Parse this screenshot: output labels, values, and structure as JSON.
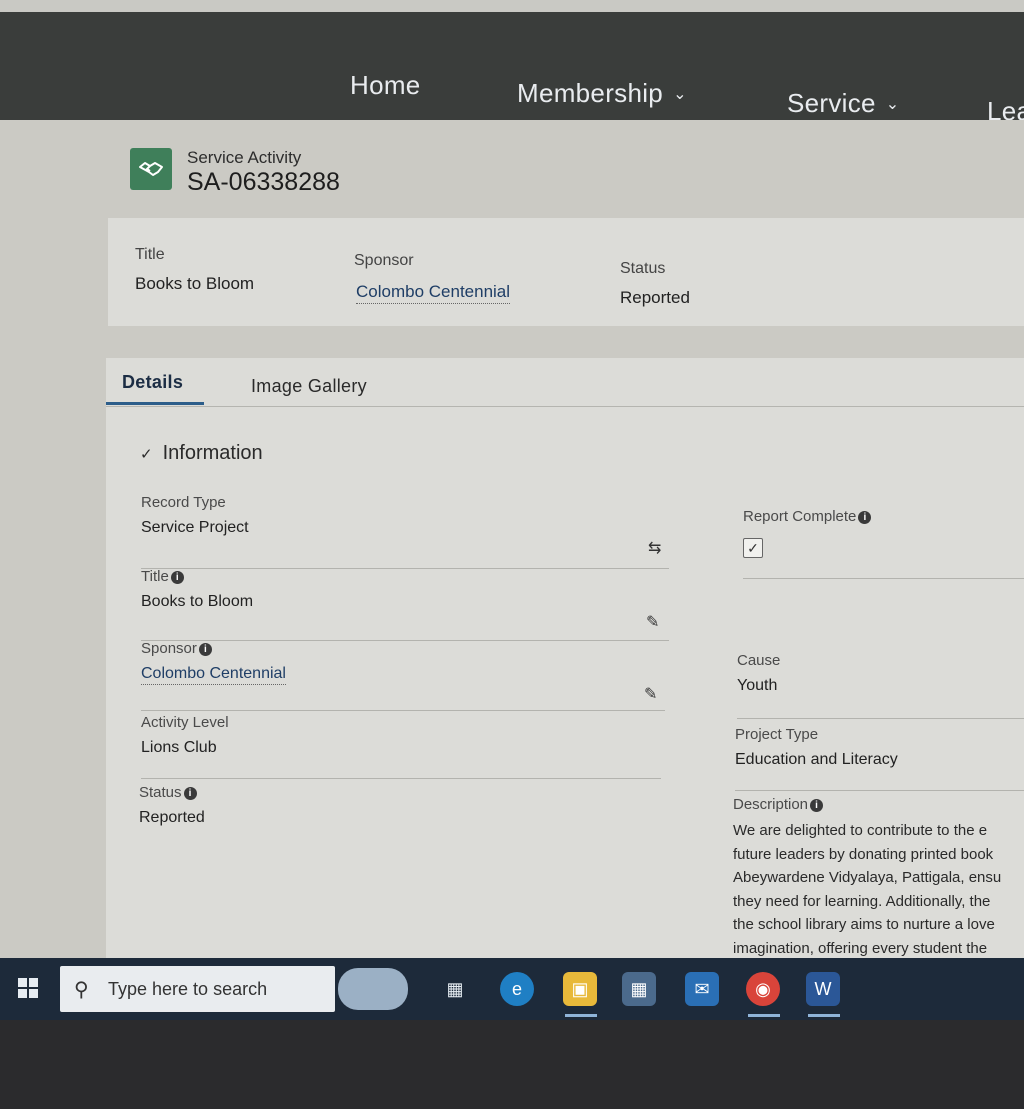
{
  "nav": {
    "home": "Home",
    "membership": "Membership",
    "service": "Service",
    "more": "Lea"
  },
  "record": {
    "object_label": "Service Activity",
    "number": "SA-06338288"
  },
  "highlights": {
    "title_label": "Title",
    "title_value": "Books to Bloom",
    "sponsor_label": "Sponsor",
    "sponsor_value": "Colombo Centennial",
    "status_label": "Status",
    "status_value": "Reported"
  },
  "tabs": [
    {
      "label": "Details",
      "active": true
    },
    {
      "label": "Image Gallery",
      "active": false
    }
  ],
  "section": {
    "title": "Information"
  },
  "fields_left": {
    "record_type_label": "Record Type",
    "record_type_value": "Service Project",
    "title_label": "Title",
    "title_value": "Books to Bloom",
    "sponsor_label": "Sponsor",
    "sponsor_value": "Colombo Centennial",
    "activity_level_label": "Activity Level",
    "activity_level_value": "Lions Club",
    "status_label": "Status",
    "status_value": "Reported"
  },
  "fields_right": {
    "report_complete_label": "Report Complete",
    "report_complete_checked": true,
    "cause_label": "Cause",
    "cause_value": "Youth",
    "project_type_label": "Project Type",
    "project_type_value": "Education and Literacy",
    "description_label": "Description",
    "description_lines": [
      "We are delighted to contribute to the e",
      "future leaders by donating printed book",
      "Abeywardene Vidyalaya, Pattigala, ensu",
      "they need for learning. Additionally, the",
      "the school library aims to nurture a love",
      "imagination, offering every student the"
    ]
  },
  "taskbar": {
    "search_placeholder": "Type here to search"
  },
  "icons": {
    "record": "handshake-icon",
    "info": "info-icon",
    "edit": "pencil-icon",
    "change_record_type": "swap-icon",
    "search": "magnifier-icon"
  },
  "colors": {
    "nav_bg": "#3a3d3b",
    "record_icon": "#3f7f5a",
    "link": "#1f3e66",
    "tab_accent": "#2c5d8a",
    "taskbar_bg": "#1d2a3a"
  }
}
